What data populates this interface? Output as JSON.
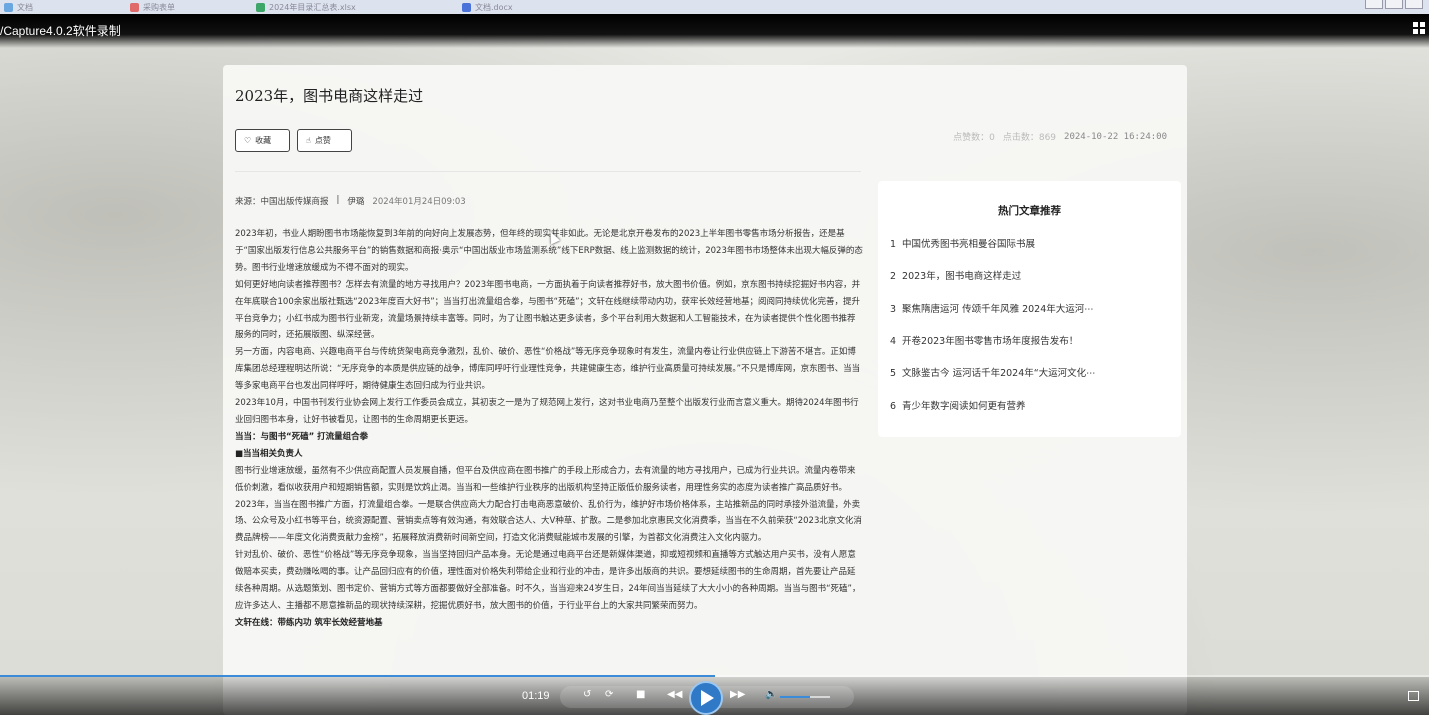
{
  "recorder": {
    "title": "/Capture4.0.2软件录制",
    "time": "01:19"
  },
  "browser_tabs": [
    {
      "label": "文档",
      "color": "#6aa7e0"
    },
    {
      "label": "采购表单",
      "color": "#e06a6a"
    },
    {
      "label": "2024年目录汇总表.xlsx",
      "color": "#3fa66a"
    },
    {
      "label": "文档.docx",
      "color": "#4a72d8"
    }
  ],
  "article": {
    "title": "2023年，图书电商这样走过",
    "fav_label": "收藏",
    "like_label": "点赞",
    "likes_text": "点赞数：0",
    "clicks_text": "点击数：869",
    "publish_time": "2024-10-22 16:24:00",
    "source": "来源：中国出版传媒商报",
    "author": "伊璐",
    "source_time": "2024年01月24日09:03",
    "paragraphs": [
      {
        "text": " 2023年初，书业人期盼图书市场能恢复到3年前的向好向上发展态势，但年终的现实并非如此。无论是北京开卷发布的2023上半年图书零售市场分析报告，还是基于“国家出版发行信息公共服务平台”的销售数据和商报·奥示“中国出版业市场监测系统”线下ERP数据、线上监测数据的统计，2023年图书市场整体未出现大幅反弹的态势。图书行业增速放缓成为不得不面对的现实。",
        "head": false
      },
      {
        "text": "如何更好地向读者推荐图书？怎样去有流量的地方寻找用户？2023年图书电商，一方面执着于向读者推荐好书，放大图书价值。例如，京东图书持续挖掘好书内容，并在年底联合100余家出版社甄选“2023年度百大好书”；当当打出流量组合拳，与图书“死磕”；文轩在线继续带动内功，获牢长效经营地基；阅阅同持续优化完善，提升平台竞争力；小红书成为图书行业新宠，流量场景持续丰富等。同时，为了让图书触达更多读者，多个平台利用大数据和人工智能技术，在为读者提供个性化图书推荐服务的同时，还拓展版图、纵深经营。",
        "head": false
      },
      {
        "text": "另一方面，内容电商、兴趣电商平台与传统货架电商竞争激烈，乱价、破价、恶性“价格战”等无序竞争现象时有发生，流量内卷让行业供应链上下游苦不堪言。正如博库集团总经理程明达所说：“无序竞争的本质是供应链的战争，博库同呼吁行业理性竞争，共建健康生态，维护行业高质量可持续发展。”不只是博库网，京东图书、当当等多家电商平台也发出同样呼吁，期待健康生态回归成为行业共识。",
        "head": false
      },
      {
        "text": "2023年10月，中国书刊发行业协会网上发行工作委员会成立，其初衷之一是为了规范网上发行，这对书业电商乃至整个出版发行业而言意义重大。期待2024年图书行业回归图书本身，让好书被看见，让图书的生命周期更长更远。",
        "head": false
      },
      {
        "text": "当当：与图书“死磕” 打流量组合拳",
        "head": true
      },
      {
        "text": "■当当相关负责人",
        "head": true
      },
      {
        "text": "图书行业增速放缓，虽然有不少供应商配置人员发展自播，但平台及供应商在图书推广的手段上形成合力，去有流量的地方寻找用户，已成为行业共识。流量内卷带来低价刺激，看似收获用户和短期销售额，实则是饮鸩止渴。当当和一些维护行业秩序的出版机构坚持正版低价服务读者，用理性务实的态度为读者推广高品质好书。",
        "head": false
      },
      {
        "text": "2023年，当当在图书推广方面，打流量组合拳。一是联合供应商大力配合打击电商恶意破价、乱价行为，维护好市场价格体系，主站推新品的同时承接外溢流量，外卖场、公众号及小红书等平台，统资源配置、营销卖点等有效沟通，有效联合达人、大V种草、扩散。二是参加北京惠民文化消费季，当当在不久前荣获“2023北京文化消费品牌榜——年度文化消费贡献力金榜”，拓展释放消费新时间新空间，打造文化消费赋能城市发展的引擎，为首都文化消费注入文化内驱力。",
        "head": false
      },
      {
        "text": "针对乱价、破价、恶性“价格战”等无序竞争现象，当当坚持回归产品本身。无论是通过电商平台还是新媒体渠道，抑或短视频和直播等方式触达用户买书，没有人愿意做赔本买卖，费劲赚吆喝的事。让产品回归应有的价值，理性面对价格失利带给企业和行业的冲击，是许多出版商的共识。要想延续图书的生命周期，首先要让产品延续各种周期。从选题策划、图书定价、营销方式等方面都要做好全部准备。时不久，当当迎来24岁生日，24年间当当延续了大大小小的各种周期。当当与图书“死磕”，应许多达人、主播都不愿意推新品的现状持续深耕，挖掘优质好书，放大图书的价值，于行业平台上的大家共同繁荣而努力。",
        "head": false
      },
      {
        "text": "文轩在线：带练内功 筑牢长效经营地基",
        "head": true
      }
    ]
  },
  "hot": {
    "title": "热门文章推荐",
    "items": [
      {
        "num": "1",
        "text": "中国优秀图书亮相曼谷国际书展"
      },
      {
        "num": "2",
        "text": "2023年，图书电商这样走过"
      },
      {
        "num": "3",
        "text": "聚焦隋唐运河 传颂千年风雅 2024年大运河⋯"
      },
      {
        "num": "4",
        "text": "开卷2023年图书零售市场年度报告发布！"
      },
      {
        "num": "5",
        "text": "文脉鉴古今 运河话千年2024年“大运河文化⋯"
      },
      {
        "num": "6",
        "text": "青少年数字阅读如何更有营养"
      }
    ]
  }
}
